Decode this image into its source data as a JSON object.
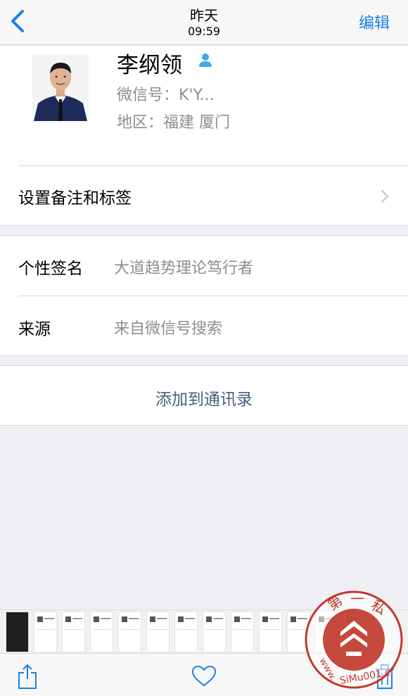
{
  "nav": {
    "title": "昨天",
    "subtitle": "09:59",
    "edit_label": "编辑",
    "back_icon": "chevron-left-icon"
  },
  "profile": {
    "name": "李纲领",
    "wechat_id": "微信号：K'Y...",
    "region": "地区：福建 厦门",
    "remark_label": "设置备注和标签"
  },
  "info": {
    "signature_label": "个性签名",
    "signature_value": "大道趋势理论笃行者",
    "source_label": "来源",
    "source_value": "来自微信号搜索"
  },
  "actions": {
    "add_contact": "添加到通讯录"
  },
  "toolbar": {
    "share_icon": "share-icon",
    "favorite_icon": "heart-icon",
    "delete_icon": "trash-icon"
  },
  "watermark": {
    "top_text": "第一私",
    "bottom_text": "www.SiMu001.c"
  },
  "colors": {
    "accent": "#1a82e0",
    "action_text": "#4a5b80",
    "secondary_text": "#8e8e93",
    "watermark_red": "#c0392b"
  }
}
